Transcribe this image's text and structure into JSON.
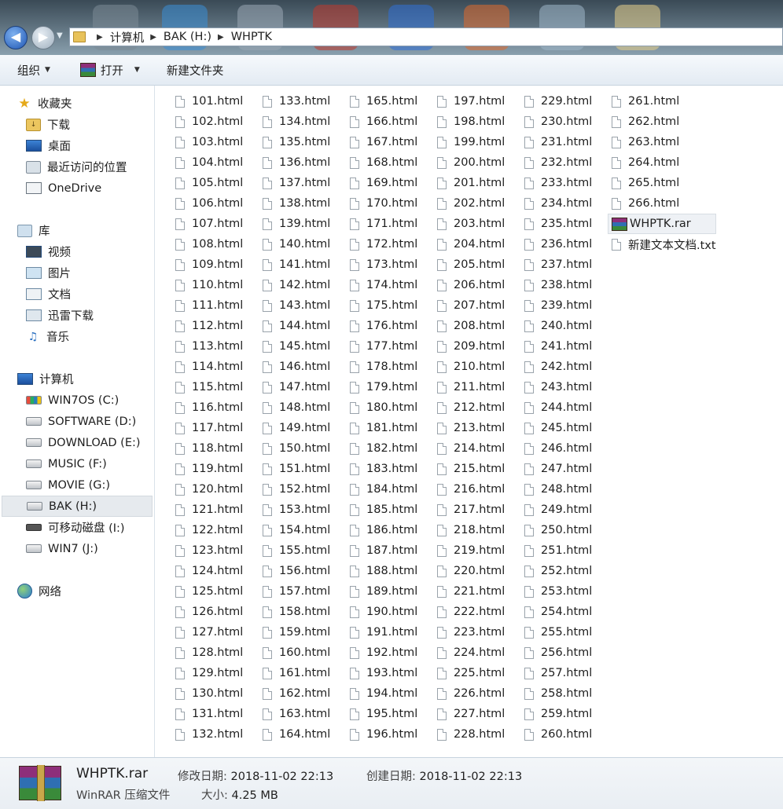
{
  "address": {
    "crumbs": [
      "计算机",
      "BAK (H:)",
      "WHPTK"
    ]
  },
  "toolbar": {
    "organize": "组织",
    "open": "打开",
    "new_folder": "新建文件夹"
  },
  "sidebar": {
    "favorites": {
      "label": "收藏夹",
      "items": [
        "下载",
        "桌面",
        "最近访问的位置",
        "OneDrive"
      ]
    },
    "libraries": {
      "label": "库",
      "items": [
        "视频",
        "图片",
        "文档",
        "迅雷下载",
        "音乐"
      ]
    },
    "computer": {
      "label": "计算机",
      "items": [
        "WIN7OS (C:)",
        "SOFTWARE (D:)",
        "DOWNLOAD (E:)",
        "MUSIC (F:)",
        "MOVIE (G:)",
        "BAK (H:)",
        "可移动磁盘 (I:)",
        "WIN7 (J:)"
      ]
    },
    "network": {
      "label": "网络"
    }
  },
  "files": {
    "html_range": [
      101,
      266
    ],
    "extra": [
      "WHPTK.rar",
      "新建文本文档.txt"
    ]
  },
  "details": {
    "name": "WHPTK.rar",
    "type": "WinRAR 压缩文件",
    "modified_label": "修改日期:",
    "modified": "2018-11-02 22:13",
    "created_label": "创建日期:",
    "created": "2018-11-02 22:13",
    "size_label": "大小:",
    "size": "4.25 MB"
  },
  "colors": {
    "title_bar": "#4b5d6a",
    "toolbar": "#e8eef4",
    "selection": "#e6eaee"
  }
}
